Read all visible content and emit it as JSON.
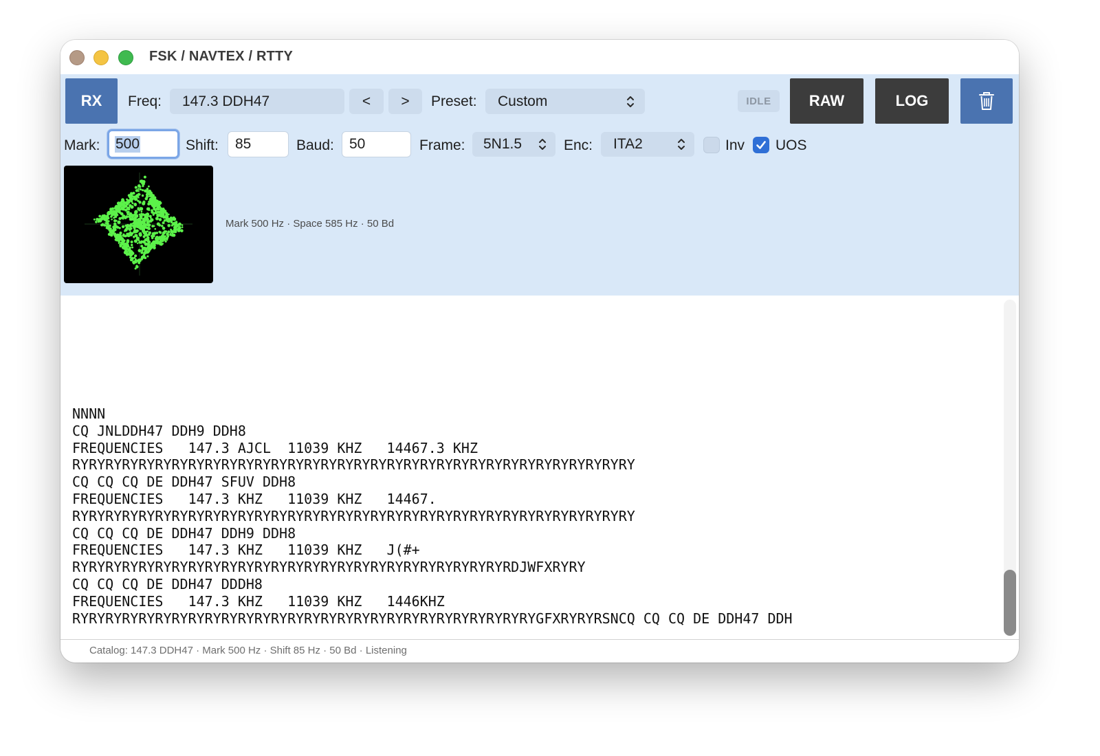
{
  "window": {
    "title": "FSK / NAVTEX / RTTY"
  },
  "toolbar": {
    "rx_label": "RX",
    "freq_label": "Freq:",
    "freq_value": "147.3 DDH47",
    "prev_label": "<",
    "next_label": ">",
    "preset_label": "Preset:",
    "preset_value": "Custom",
    "status": "IDLE",
    "raw_label": "RAW",
    "log_label": "LOG",
    "trash_icon": "trash-icon"
  },
  "params": {
    "mark_label": "Mark:",
    "mark_value": "500",
    "shift_label": "Shift:",
    "shift_value": "85",
    "baud_label": "Baud:",
    "baud_value": "50",
    "frame_label": "Frame:",
    "frame_value": "5N1.5",
    "enc_label": "Enc:",
    "enc_value": "ITA2",
    "inv_label": "Inv",
    "inv_checked": false,
    "uos_label": "UOS",
    "uos_checked": true
  },
  "scope": {
    "caption": "Mark 500 Hz · Space 585 Hz · 50 Bd",
    "trace_color": "#5cf24a"
  },
  "output": {
    "lines": [
      "NNNN",
      "CQ JNLDDH47 DDH9 DDH8",
      "FREQUENCIES   147.3 AJCL  11039 KHZ   14467.3 KHZ",
      "RYRYRYRYRYRYRYRYRYRYRYRYRYRYRYRYRYRYRYRYRYRYRYRYRYRYRYRYRYRYRYRYRYRY",
      "CQ CQ CQ DE DDH47 SFUV DDH8",
      "FREQUENCIES   147.3 KHZ   11039 KHZ   14467.",
      "RYRYRYRYRYRYRYRYRYRYRYRYRYRYRYRYRYRYRYRYRYRYRYRYRYRYRYRYRYRYRYRYRYRY",
      "CQ CQ CQ DE DDH47 DDH9 DDH8",
      "FREQUENCIES   147.3 KHZ   11039 KHZ   J(#+",
      "RYRYRYRYRYRYRYRYRYRYRYRYRYRYRYRYRYRYRYRYRYRYRYRYRYRYRDJWFXRYRY",
      "CQ CQ CQ DE DDH47 DDDH8",
      "FREQUENCIES   147.3 KHZ   11039 KHZ   1446KHZ",
      "RYRYRYRYRYRYRYRYRYRYRYRYRYRYRYRYRYRYRYRYRYRYRYRYRYRYRYRYGFXRYRYRSNCQ CQ CQ DE DDH47 DDH"
    ]
  },
  "statusbar": {
    "text": "Catalog: 147.3 DDH47 · Mark 500 Hz · Shift 85 Hz · 50 Bd · Listening"
  }
}
